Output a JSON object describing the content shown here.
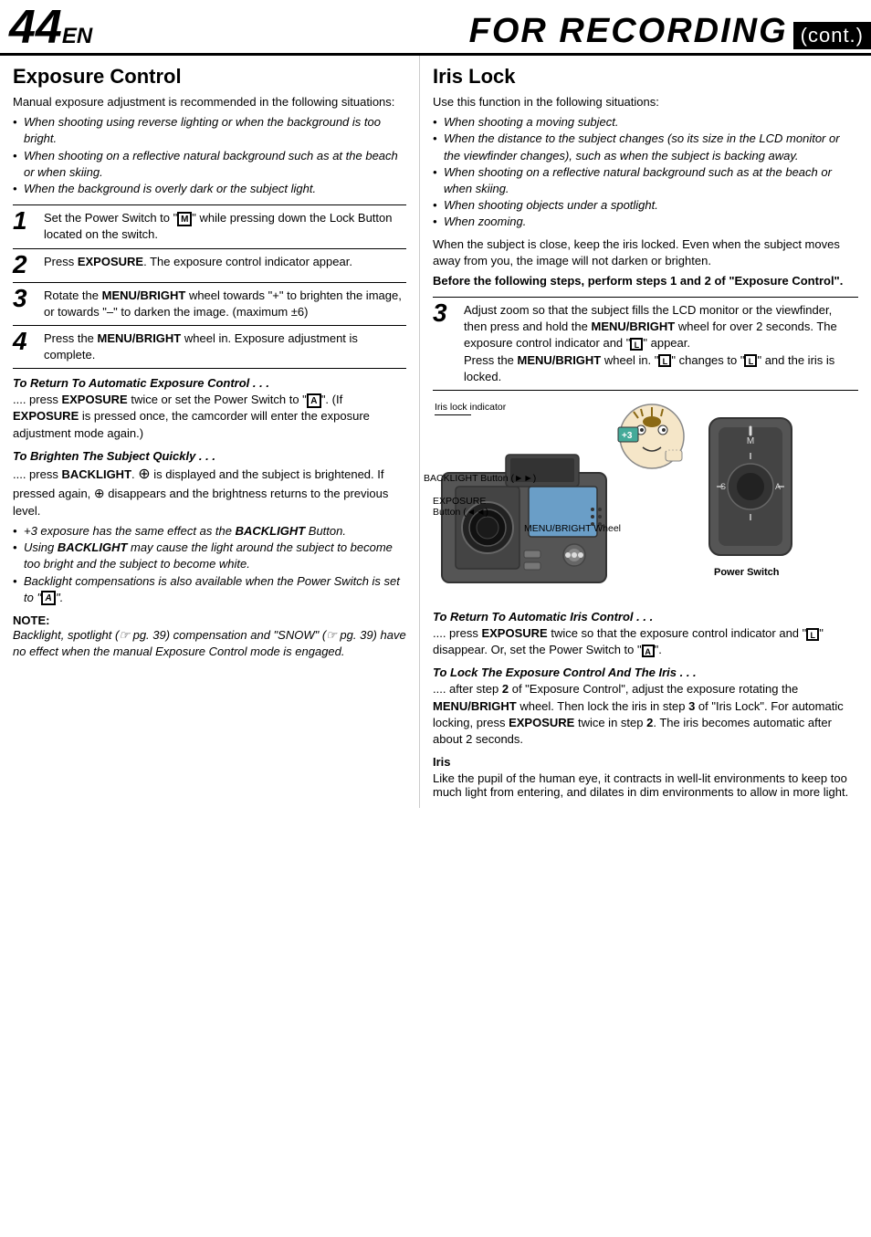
{
  "header": {
    "page_number": "44",
    "page_suffix": "EN",
    "title": "FOR RECORDING",
    "cont_label": "(cont.)"
  },
  "left": {
    "section_title": "Exposure Control",
    "intro": "Manual exposure adjustment is recommended in the following situations:",
    "bullets": [
      "When shooting using reverse lighting or when the background is too bright.",
      "When shooting on a reflective natural background such as at the beach or when skiing.",
      "When the background is overly dark or the subject light."
    ],
    "steps": [
      {
        "num": "1",
        "text": "Set the Power Switch to \"Ⓜ\" while pressing down the Lock Button located on the switch."
      },
      {
        "num": "2",
        "text_before": "Press ",
        "bold": "EXPOSURE",
        "text_after": ". The exposure control indicator appear."
      },
      {
        "num": "3",
        "text_before": "Rotate the ",
        "bold": "MENU/BRIGHT",
        "text_after": " wheel towards “+” to brighten the image, or towards “–” to darken the image. (maximum ±6)"
      },
      {
        "num": "4",
        "text_before": "Press the ",
        "bold": "MENU/BRIGHT",
        "text_after": " wheel in. Exposure adjustment is complete."
      }
    ],
    "to_return_title": "To Return To Automatic Exposure Control . . .",
    "to_return_body": ".... press EXPOSURE twice or set the Power Switch to \"Ⓐ\". (If EXPOSURE is pressed once, the camcorder will enter the exposure adjustment mode again.)",
    "to_brighten_title": "To Brighten The Subject Quickly . . .",
    "to_brighten_body_1": ".... press BACKLIGHT. ⊙ is displayed and the subject is brightened. If pressed again, ⊙ disappears and the brightness returns to the previous level.",
    "to_brighten_bullets": [
      "+3 exposure has the same effect as the BACKLIGHT Button.",
      "Using BACKLIGHT may cause the light around the subject to become too bright and the subject to become white.",
      "Backlight compensations is also available when the Power Switch is set to \"Ⓐ\"."
    ],
    "note_title": "NOTE:",
    "note_body": "Backlight, spotlight (☰ pg. 39) compensation and “SNOW” (☰ pg. 39) have no effect when the manual Exposure Control mode is engaged."
  },
  "right": {
    "section_title": "Iris Lock",
    "intro": "Use this function in the following situations:",
    "bullets": [
      "When shooting a moving subject.",
      "When the distance to the subject changes (so its size in the LCD monitor or the viewfinder changes), such as when the subject is backing away.",
      "When shooting on a reflective natural background such as at the beach or when skiing.",
      "When shooting objects under a spotlight.",
      "When zooming."
    ],
    "iris_note_1": "When the subject is close, keep the iris locked. Even when the subject moves away from you, the image will not darken or brighten.",
    "iris_note_bold": "Before the following steps, perform steps 1 and 2 of “Exposure Control”.",
    "step3": {
      "num": "3",
      "text": "Adjust zoom so that the subject fills the LCD monitor or the viewfinder, then press and hold the MENU/BRIGHT wheel for over 2 seconds. The exposure control indicator and “Ⓛ” appear.\nPress the MENU/BRIGHT wheel in. “Ⓛ” changes to “Ⓛ” and the iris is locked."
    },
    "diagram": {
      "iris_lock_indicator": "Iris lock indicator",
      "backlight_button": "BACKLIGHT Button (►►)",
      "exposure_button": "EXPOSURE\nButton (◄◄)",
      "menu_bright_wheel": "MENU/BRIGHT Wheel",
      "power_switch": "Power Switch"
    },
    "to_return_iris_title": "To Return To Automatic Iris Control . . .",
    "to_return_iris_body": ".... press EXPOSURE twice so that the exposure control indicator and “Ⓛ” disappear. Or, set the Power Switch to “Ⓐ”.",
    "to_lock_title": "To Lock The Exposure Control And The Iris . . .",
    "to_lock_body": ".... after step 2 of “Exposure Control”, adjust the exposure rotating the MENU/BRIGHT wheel. Then lock the iris in step 3 of “Iris Lock”. For automatic locking, press EXPOSURE twice in step 2. The iris becomes automatic after about 2 seconds.",
    "iris_title": "Iris",
    "iris_body": "Like the pupil of the human eye, it contracts in well-lit environments to keep too much light from entering, and dilates in dim environments to allow in more light."
  }
}
